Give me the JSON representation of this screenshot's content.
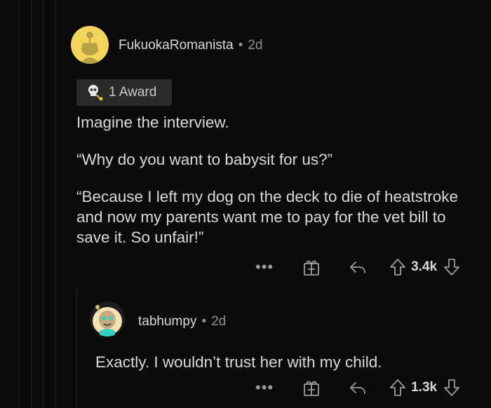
{
  "comment": {
    "username": "FukuokaRomanista",
    "age": "2d",
    "award": "1 Award",
    "paragraphs": [
      "Imagine the interview.",
      "“Why do you want to babysit for us?”",
      "“Because I left my dog on the deck to die of heatstroke and now my parents want me to pay for the vet bill to save it. So unfair!”"
    ],
    "votes": "3.4k",
    "more": "•••"
  },
  "reply": {
    "username": "tabhumpy",
    "age": "2d",
    "text": "Exactly. I wouldn’t trust her with my child.",
    "votes": "1.3k",
    "more": "•••"
  },
  "separator": "•",
  "icons": {
    "award": "skull-award-icon",
    "gift": "gift-icon",
    "reply": "reply-arrow-icon",
    "upvote": "upvote-arrow-icon",
    "downvote": "downvote-arrow-icon"
  },
  "colors": {
    "background": "#0b0b0b",
    "text": "#d7dadc",
    "muted": "#8e9194",
    "avatar_bg_1": "#f4d55c",
    "award_bg": "#2a2a2b"
  }
}
